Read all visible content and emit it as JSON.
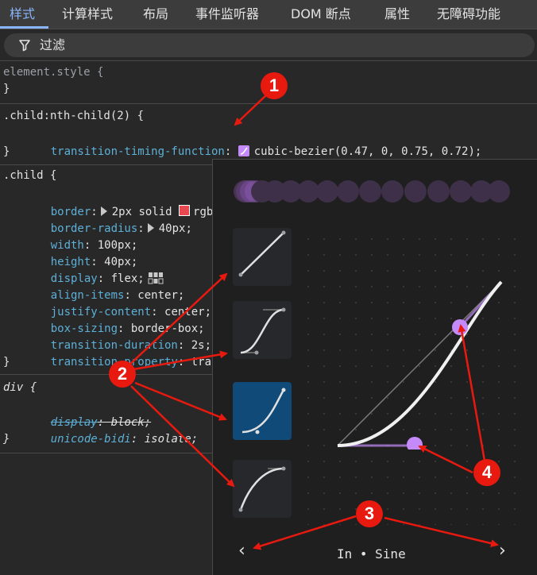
{
  "tabs": [
    {
      "label": "样式",
      "active": true
    },
    {
      "label": "计算样式"
    },
    {
      "label": "布局"
    },
    {
      "label": "事件监听器"
    },
    {
      "label": "DOM 断点"
    },
    {
      "label": "属性"
    },
    {
      "label": "无障碍功能"
    }
  ],
  "filter": {
    "label": "过滤"
  },
  "rules": {
    "element_style": {
      "selector": "element.style {",
      "close": "}"
    },
    "nth_child": {
      "selector": ".child:nth-child(2) {",
      "prop": "transition-timing-function",
      "value": "cubic-bezier(0.47, 0, 0.75, 0.72);",
      "close": "}"
    },
    "child": {
      "selector": ".child {",
      "decls": [
        {
          "prop": "border",
          "value": "2px solid ",
          "extra": "rgba"
        },
        {
          "prop": "border-radius",
          "value": "40px;"
        },
        {
          "prop": "width",
          "value": "100px;"
        },
        {
          "prop": "height",
          "value": "40px;"
        },
        {
          "prop": "display",
          "value": "flex;"
        },
        {
          "prop": "align-items",
          "value": "center;"
        },
        {
          "prop": "justify-content",
          "value": "center;"
        },
        {
          "prop": "box-sizing",
          "value": "border-box;"
        },
        {
          "prop": "transition-duration",
          "value": "2s;"
        },
        {
          "prop": "transition-property",
          "value": "trans"
        }
      ],
      "close": "}"
    },
    "div": {
      "selector": "div {",
      "decls": [
        {
          "prop": "display",
          "value": "block;",
          "struck": true
        },
        {
          "prop": "unicode-bidi",
          "value": "isolate;"
        }
      ],
      "close": "}"
    }
  },
  "editor": {
    "preset_label": "In • Sine",
    "prev_arrow": "‹",
    "next_arrow": "›",
    "cubic_bezier": [
      0.47,
      0,
      0.75,
      0.72
    ],
    "accent_color": "#c58af9",
    "selected_preset_color": "#0f4a78"
  },
  "annotations": {
    "badge1": "1",
    "badge2": "2",
    "badge3": "3",
    "badge4": "4",
    "color": "#e8190f"
  }
}
